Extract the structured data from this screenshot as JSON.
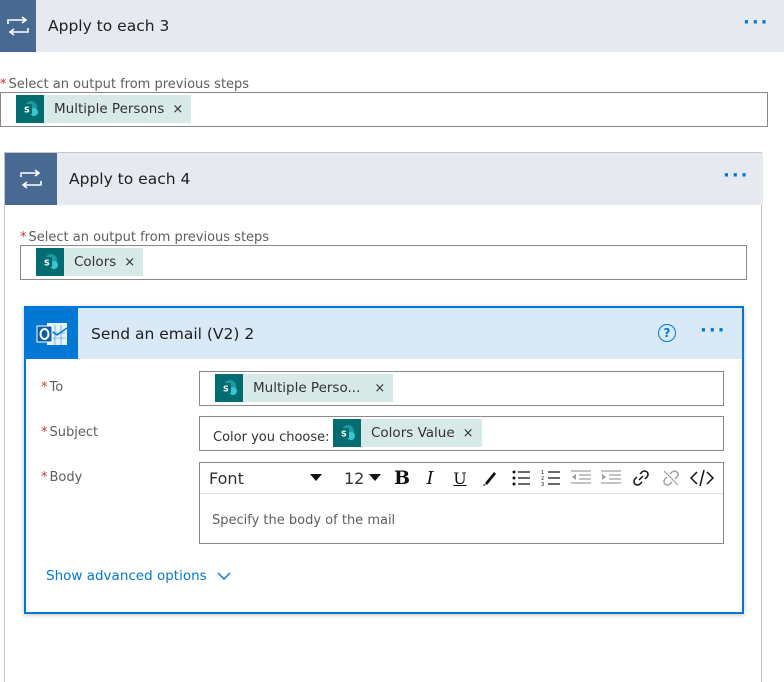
{
  "outer_loop": {
    "title": "Apply to each 3",
    "menu": "···",
    "field_label": "Select an output from previous steps",
    "token": {
      "label": "Multiple Persons",
      "remove": "×"
    }
  },
  "inner_loop": {
    "title": "Apply to each 4",
    "menu": "···",
    "field_label": "Select an output from previous steps",
    "token": {
      "label": "Colors",
      "remove": "×"
    }
  },
  "email": {
    "title": "Send an email (V2) 2",
    "help": "?",
    "menu": "···",
    "to": {
      "label": "To",
      "token": {
        "label": "Multiple Perso...",
        "remove": "×"
      }
    },
    "subject": {
      "label": "Subject",
      "prefix": "Color you choose:",
      "token": {
        "label": "Colors Value",
        "remove": "×"
      }
    },
    "body": {
      "label": "Body",
      "font": "Font",
      "size": "12",
      "bold": "B",
      "italic": "I",
      "underline": "U",
      "placeholder": "Specify the body of the mail"
    },
    "advanced": "Show advanced options"
  },
  "required_mark": "*",
  "icons": {
    "loop": "loop-icon",
    "sharepoint": "sharepoint-icon",
    "outlook": "outlook-icon"
  },
  "colors": {
    "loop_accent": "#486991",
    "loop_header_bg": "#e6e9f0",
    "email_accent": "#0078d4",
    "email_header_bg": "#d9e9f8",
    "token_bg": "#d8eae8",
    "sharepoint": "#036c70",
    "required": "#d13438"
  }
}
